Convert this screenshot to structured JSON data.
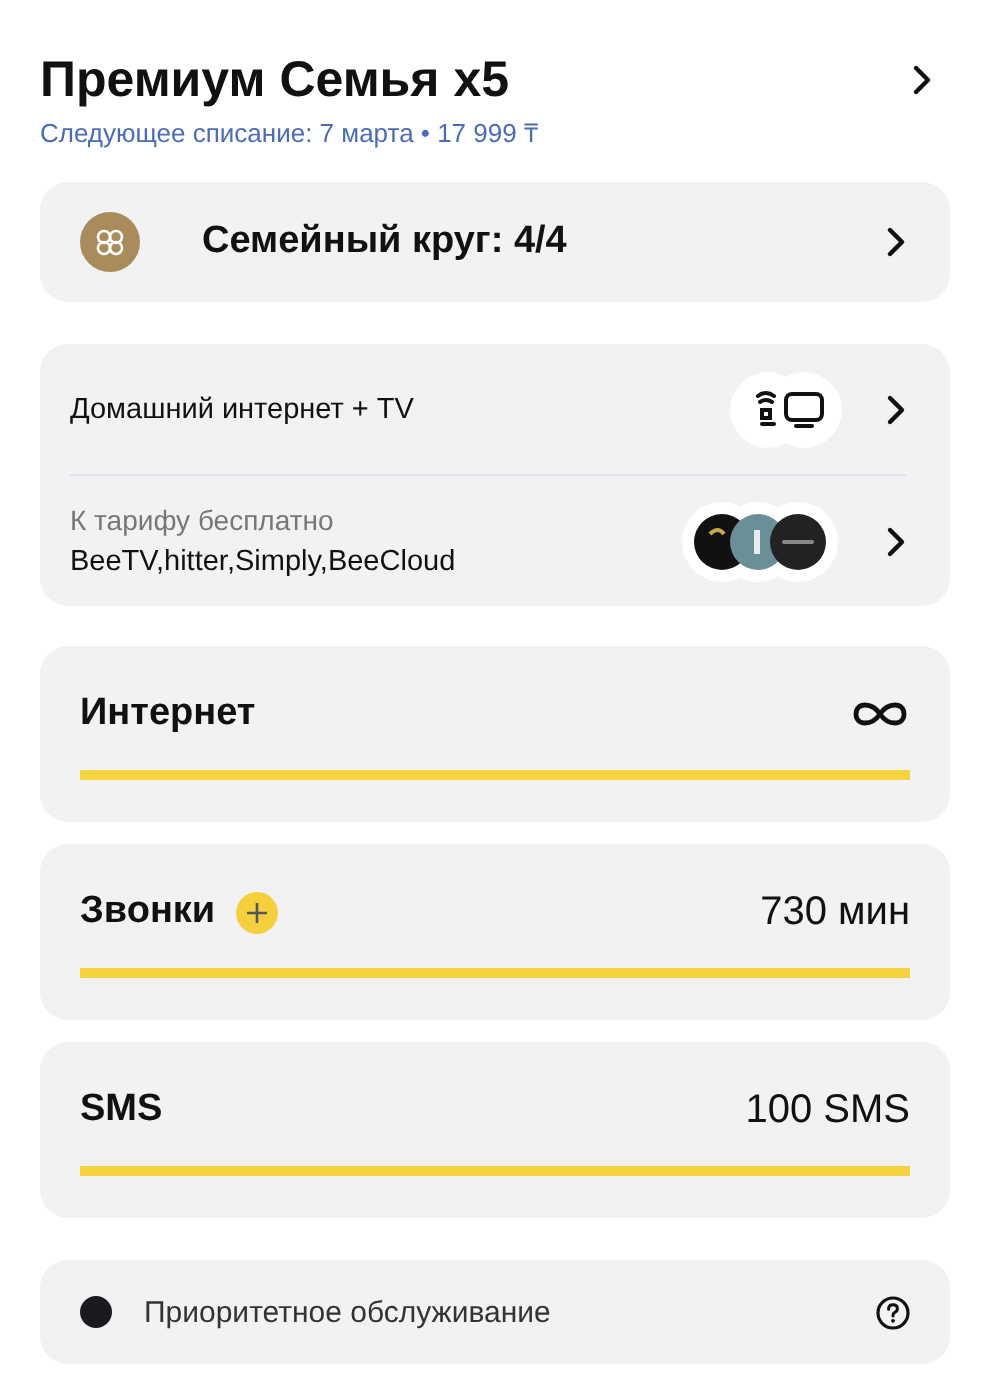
{
  "header": {
    "title": "Премиум Семья x5",
    "subtitle": "Следующее списание: 7 марта • 17 999 ₸"
  },
  "family": {
    "label": "Семейный круг: 4/4"
  },
  "services": [
    {
      "kind": "home",
      "label": "Домашний интернет + TV"
    },
    {
      "kind": "free",
      "caption": "К тарифу бесплатно",
      "label": "BeeTV,hitter,Simply,BeeCloud"
    }
  ],
  "usage": [
    {
      "name": "Интернет",
      "unlimited": true,
      "addable": false,
      "level": 1
    },
    {
      "name": "Звонки",
      "unlimited": false,
      "addable": true,
      "value": "730 мин",
      "level": 1
    },
    {
      "name": "SMS",
      "unlimited": false,
      "addable": false,
      "value": "100 SMS",
      "level": 1
    }
  ],
  "priority": {
    "label": "Приоритетное обслуживание",
    "active": true
  }
}
